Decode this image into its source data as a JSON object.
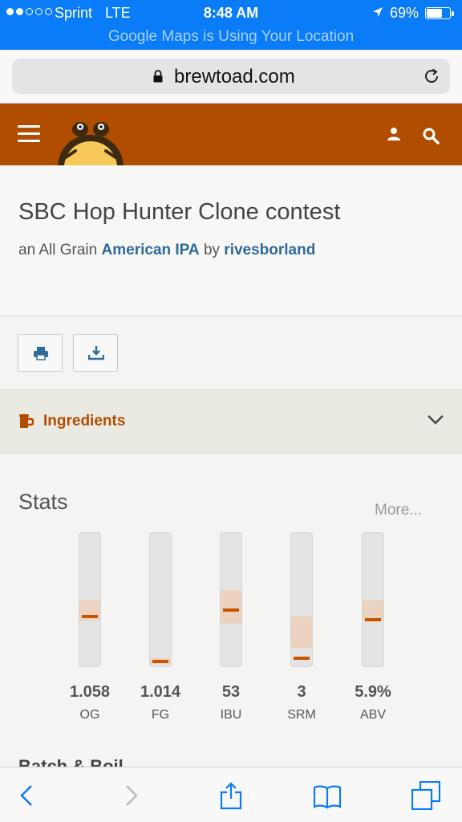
{
  "status_bar": {
    "carrier": "Sprint",
    "network": "LTE",
    "time": "8:48 AM",
    "battery_percent": "69%",
    "battery_level": 0.69,
    "signal_bars_filled": 2,
    "banner": "Google Maps is Using Your Location"
  },
  "browser": {
    "url": "brewtoad.com"
  },
  "recipe": {
    "title": "SBC Hop Hunter Clone contest",
    "subtitle_prefix": "an All Grain",
    "style_link": "American IPA",
    "subtitle_by": "by",
    "author_link": "rivesborland"
  },
  "sections": {
    "ingredients_label": "Ingredients"
  },
  "stats": {
    "heading": "Stats",
    "more_label": "More...",
    "items": [
      {
        "label": "OG",
        "value": "1.058",
        "range_low": 0.5,
        "range_high": 0.65,
        "marker": 0.62
      },
      {
        "label": "FG",
        "value": "1.014",
        "range_low": 0.93,
        "range_high": 0.97,
        "marker": 0.95
      },
      {
        "label": "IBU",
        "value": "53",
        "range_low": 0.42,
        "range_high": 0.67,
        "marker": 0.57
      },
      {
        "label": "SRM",
        "value": "3",
        "range_low": 0.62,
        "range_high": 0.85,
        "marker": 0.93
      },
      {
        "label": "ABV",
        "value": "5.9%",
        "range_low": 0.5,
        "range_high": 0.65,
        "marker": 0.64
      }
    ],
    "next_section": "Batch & Boil"
  },
  "colors": {
    "brand": "#b04d00",
    "link": "#2f6b9a",
    "ios_blue": "#0a7cf7",
    "marker": "#c95400",
    "range": "#ecd3c0"
  },
  "toolbar": {
    "icons": [
      "back-icon",
      "forward-icon",
      "share-icon",
      "bookmarks-icon",
      "tabs-icon"
    ]
  }
}
